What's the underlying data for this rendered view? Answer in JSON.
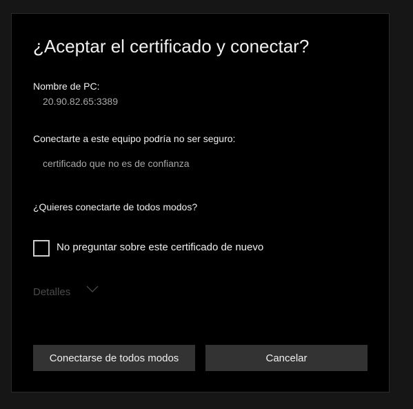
{
  "dialog": {
    "title": "¿Aceptar el certificado y conectar?",
    "pc_name_label": "Nombre de PC:",
    "pc_name_value": "20.90.82.65:3389",
    "warning_label": "Conectarte a este equipo podría no ser seguro:",
    "warning_value": "certificado que no es de confianza",
    "question": "¿Quieres conectarte de todos modos?",
    "checkbox_label": "No preguntar sobre este certificado de nuevo",
    "checkbox_checked": false,
    "details_label": "Detalles",
    "details_icon": "chevron-down-icon",
    "connect_button": "Conectarse de todos modos",
    "cancel_button": "Cancelar"
  }
}
